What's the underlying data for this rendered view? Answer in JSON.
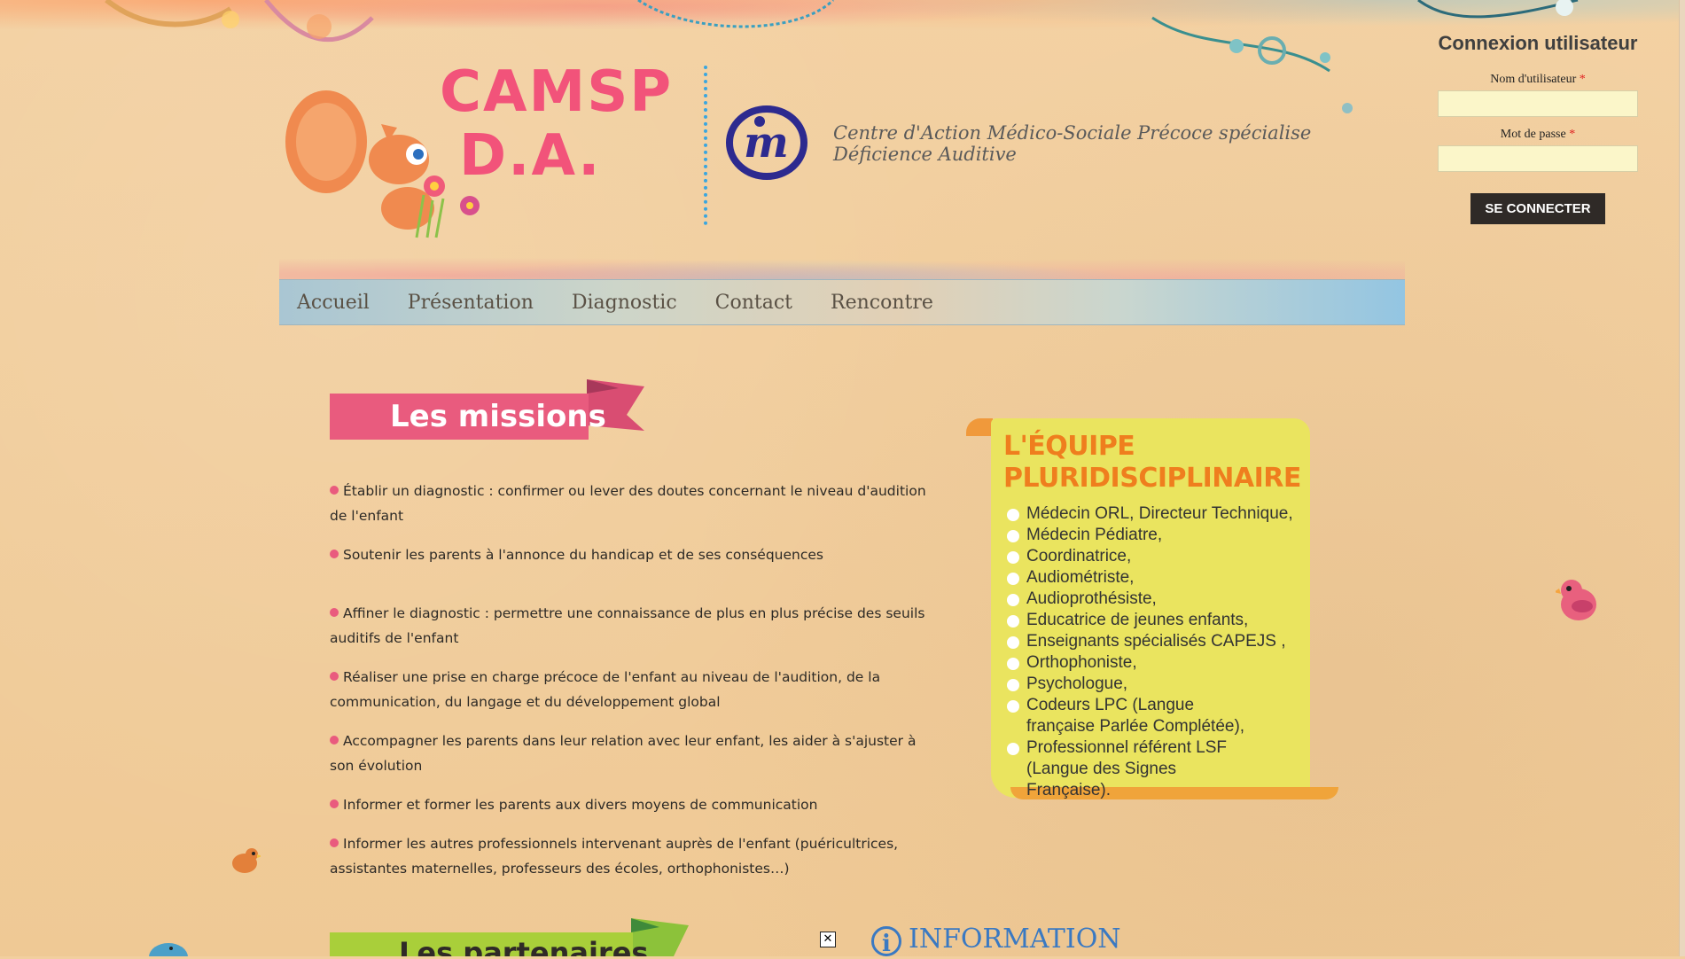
{
  "header": {
    "logo_text_line1": "CAMSP",
    "logo_text_line2": "D.A.",
    "tagline": "Centre d'Action Médico-Sociale Précoce spécialise Déficience Auditive"
  },
  "nav": {
    "items": [
      {
        "label": "Accueil"
      },
      {
        "label": "Présentation"
      },
      {
        "label": "Diagnostic"
      },
      {
        "label": "Contact"
      },
      {
        "label": "Rencontre"
      }
    ]
  },
  "login": {
    "title": "Connexion utilisateur",
    "username_label": "Nom d'utilisateur",
    "password_label": "Mot de passe",
    "required_mark": "*",
    "submit_label": "SE CONNECTER",
    "username_value": "",
    "password_value": ""
  },
  "missions": {
    "title": "Les missions",
    "items": [
      "Établir un diagnostic : confirmer ou lever des doutes concernant le niveau d'audition de l'enfant",
      "Soutenir les parents à l'annonce du handicap et de ses conséquences",
      "Affiner le diagnostic : permettre une connaissance de plus en plus précise des seuils auditifs de l'enfant",
      "Réaliser une prise en charge précoce de l'enfant au niveau de l'audition, de la communication, du langage et du développement global",
      "Accompagner les parents dans leur relation avec leur enfant, les aider à s'ajuster à son évolution",
      "Informer et former les parents aux divers moyens de communication",
      "Informer les autres professionnels intervenant auprès de l'enfant (puéricultrices, assistantes maternelles, professeurs des écoles, orthophonistes…)"
    ]
  },
  "equipe": {
    "title_line1": "L'ÉQUIPE",
    "title_line2": "PLURIDISCIPLINAIRE",
    "members": [
      "Médecin ORL, Directeur Technique,",
      "Médecin Pédiatre,",
      "Coordinatrice,",
      "Audiométriste,",
      "Audioprothésiste,",
      "Educatrice de jeunes enfants,",
      "Enseignants spécialisés CAPEJS ,",
      "Orthophoniste,",
      "Psychologue,",
      "Codeurs LPC (Langue française Parlée Complétée),",
      "Professionnel référent LSF (Langue des Signes Française)."
    ]
  },
  "partenaires": {
    "title": "Les partenaires"
  },
  "info": {
    "title": "INFORMATION",
    "icon": "info-icon"
  },
  "colors": {
    "background": "#f2cf9f",
    "accent_pink": "#e95b7e",
    "accent_green": "#a9cf3a",
    "equipe_yellow": "#eae45f",
    "equipe_orange": "#ef7e1e",
    "info_blue": "#3a79c2",
    "button_dark": "#2f2a27"
  }
}
